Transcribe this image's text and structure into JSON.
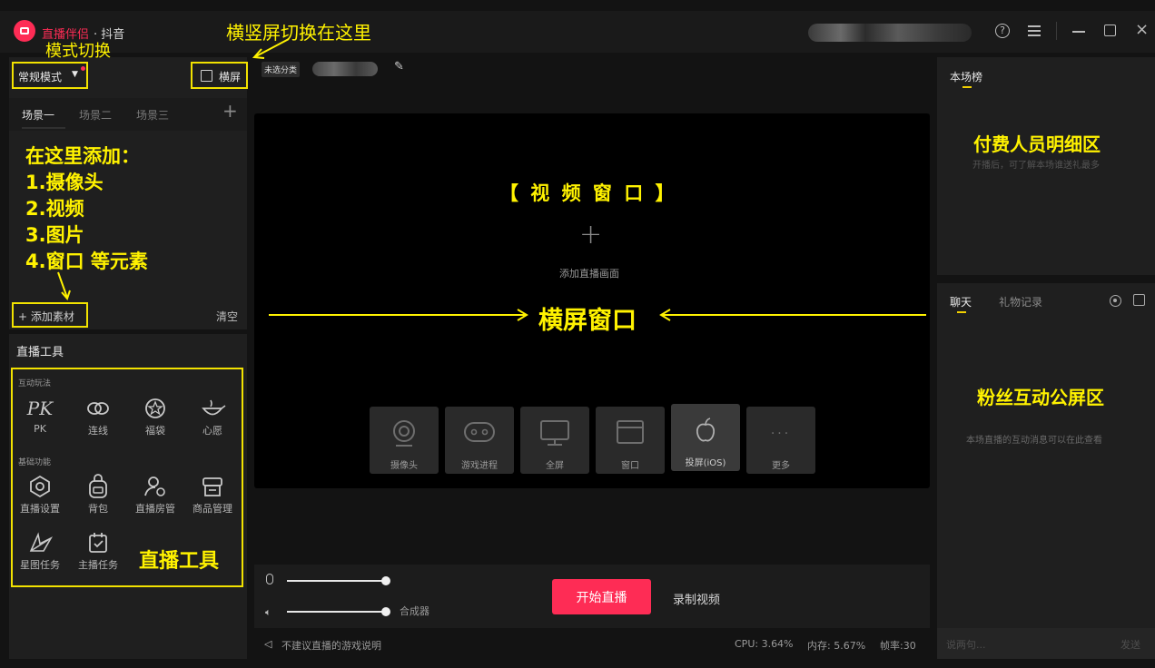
{
  "app": {
    "name": "直播伴侣",
    "platform": "· 抖音",
    "window_controls": [
      "help-icon",
      "menu-icon",
      "minimize-icon",
      "maximize-icon",
      "close-icon"
    ]
  },
  "annotations": {
    "mode_switch": "模式切换",
    "orientation_switch": "横竖屏切换在这里",
    "add_here_title": "在这里添加：",
    "add_items": [
      "1.摄像头",
      "2.视频",
      "3.图片",
      "4.窗口 等元素"
    ],
    "video_window": "【 视 频 窗 口 】",
    "landscape_window": "横屏窗口",
    "paid_detail": "付费人员明细区",
    "fan_chat": "粉丝互动公屏区",
    "live_tools": "直播工具"
  },
  "left": {
    "mode": "常规模式",
    "orientation_button": "横屏",
    "scenes": [
      "场景一",
      "场景二",
      "场景三"
    ],
    "add_material": "+ 添加素材",
    "clear": "清空",
    "tools_title": "直播工具",
    "interactive_section": "互动玩法",
    "interactive": [
      {
        "label": "PK",
        "icon": "pk-icon"
      },
      {
        "label": "连线",
        "icon": "link-icon"
      },
      {
        "label": "福袋",
        "icon": "lucky-bag-icon"
      },
      {
        "label": "心愿",
        "icon": "wish-icon"
      }
    ],
    "basic_section": "基础功能",
    "basic": [
      {
        "label": "直播设置",
        "icon": "settings-hex-icon"
      },
      {
        "label": "背包",
        "icon": "backpack-icon"
      },
      {
        "label": "直播房管",
        "icon": "room-admin-icon"
      },
      {
        "label": "商品管理",
        "icon": "store-icon"
      },
      {
        "label": "星图任务",
        "icon": "star-map-icon"
      },
      {
        "label": "主播任务",
        "icon": "task-icon"
      }
    ]
  },
  "center": {
    "category": "未选分类",
    "add_screen": "添加直播画面",
    "sources": [
      {
        "label": "摄像头",
        "icon": "camera-icon"
      },
      {
        "label": "游戏进程",
        "icon": "gamepad-icon"
      },
      {
        "label": "全屏",
        "icon": "monitor-icon"
      },
      {
        "label": "窗口",
        "icon": "window-icon"
      },
      {
        "label": "投屏(iOS)",
        "icon": "apple-icon"
      },
      {
        "label": "更多",
        "icon": "more-icon"
      }
    ],
    "mixer_label": "合成器",
    "start_live": "开始直播",
    "record": "录制视频",
    "notice": "不建议直播的游戏说明",
    "cpu": "CPU: 3.64%",
    "memory": "内存: 5.67%",
    "fps": "帧率:30"
  },
  "right": {
    "ranking_tab": "本场榜",
    "ranking_empty": "开播后，可了解本场谁送礼最多",
    "chat_tab": "聊天",
    "gift_tab": "礼物记录",
    "chat_empty": "本场直播的互动消息可以在此查看",
    "input_placeholder": "说两句...",
    "send": "发送"
  },
  "colors": {
    "accent": "#fe2c55",
    "annotation": "#fff200",
    "bg": "#131313",
    "panel": "#1f1f1f"
  }
}
